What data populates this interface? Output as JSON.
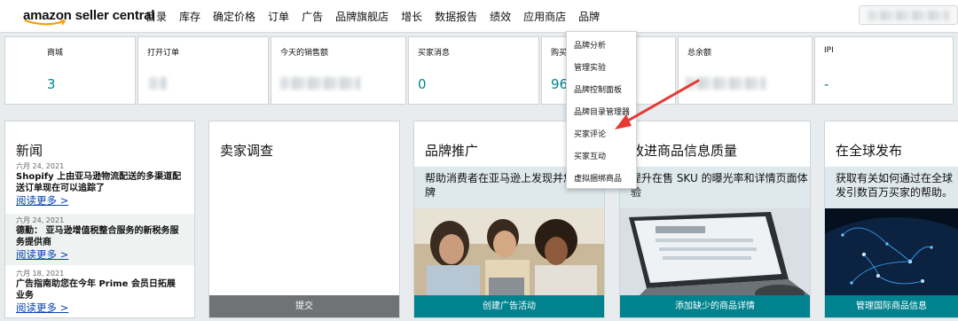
{
  "header": {
    "logo_text": "amazon seller central",
    "nav": [
      "目录",
      "库存",
      "确定价格",
      "订单",
      "广告",
      "品牌旗舰店",
      "增长",
      "数据报告",
      "绩效",
      "应用商店",
      "品牌"
    ]
  },
  "metrics": [
    {
      "label": "商城",
      "value": "3"
    },
    {
      "label": "打开订单",
      "value": ""
    },
    {
      "label": "今天的销售额",
      "value": ""
    },
    {
      "label": "买家消息",
      "value": "0"
    },
    {
      "label": "购买",
      "value": "96"
    },
    {
      "label": "总余额",
      "value": ""
    },
    {
      "label": "IPI",
      "value": "-"
    }
  ],
  "brand_menu": {
    "items": [
      "品牌分析",
      "管理实验",
      "品牌控制面板",
      "品牌目录管理器",
      "买家评论",
      "买家互动",
      "虚拟捆绑商品"
    ]
  },
  "news": {
    "title": "新闻",
    "items": [
      {
        "date": "六月 24, 2021",
        "title": "Shopify 上由亚马逊物流配送的多渠道配送订单现在可以追踪了",
        "link": "阅读更多 >"
      },
      {
        "date": "六月 24, 2021",
        "title": "德勤： 亚马逊增值税整合服务的新税务服务提供商",
        "link": "阅读更多 >"
      },
      {
        "date": "六月 18, 2021",
        "title": "广告指南助您在今年 Prime 会员日拓展业务",
        "link": "阅读更多 >"
      }
    ]
  },
  "survey": {
    "title": "卖家调查",
    "button": "提交"
  },
  "brand_promo": {
    "title": "品牌推广",
    "desc": "帮助消费者在亚马逊上发现并您的品牌",
    "button": "创建广告活动"
  },
  "listing_quality": {
    "title": "改进商品信息质量",
    "desc": "提升在售 SKU 的曝光率和详情页面体验",
    "button": "添加缺少的商品详情"
  },
  "global": {
    "title": "在全球发布",
    "desc": "获取有关如何通过在全球发引数百万买家的帮助。",
    "button": "管理国际商品信息"
  },
  "colors": {
    "teal": "#00838f",
    "arrow": "#e53935",
    "link": "#0645ad"
  }
}
